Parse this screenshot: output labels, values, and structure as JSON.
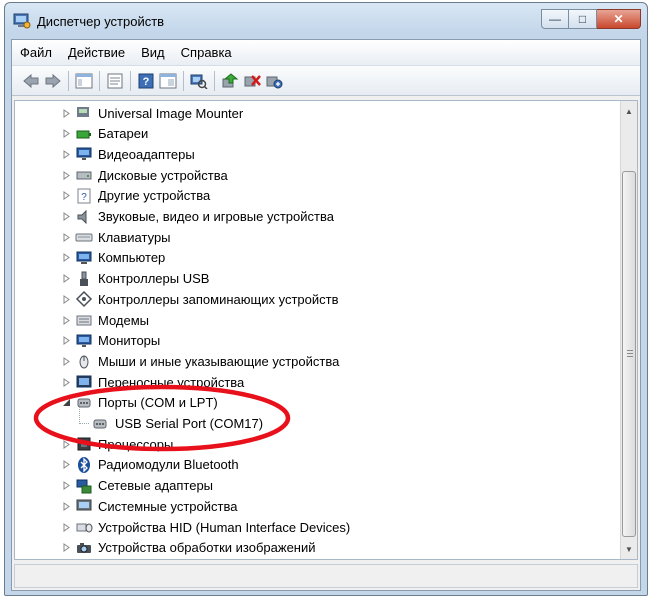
{
  "window": {
    "title": "Диспетчер устройств",
    "buttons": {
      "minimize": "—",
      "maximize": "□",
      "close": "✕"
    }
  },
  "menubar": {
    "items": [
      "Файл",
      "Действие",
      "Вид",
      "Справка"
    ]
  },
  "toolbar": {
    "icons": [
      "back-arrow-icon",
      "forward-arrow-icon",
      "show-hide-tree-icon",
      "properties-icon",
      "help-icon",
      "view-pane-icon",
      "scan-hardware-icon",
      "update-driver-icon",
      "disable-device-icon",
      "uninstall-device-icon"
    ]
  },
  "tree": {
    "nodes": [
      {
        "label": "Universal Image Mounter",
        "icon": "image-mounter-icon",
        "expanded": false
      },
      {
        "label": "Батареи",
        "icon": "battery-icon",
        "expanded": false
      },
      {
        "label": "Видеоадаптеры",
        "icon": "display-adapter-icon",
        "expanded": false
      },
      {
        "label": "Дисковые устройства",
        "icon": "disk-drive-icon",
        "expanded": false
      },
      {
        "label": "Другие устройства",
        "icon": "unknown-device-icon",
        "expanded": false
      },
      {
        "label": "Звуковые, видео и игровые устройства",
        "icon": "speaker-icon",
        "expanded": false
      },
      {
        "label": "Клавиатуры",
        "icon": "keyboard-icon",
        "expanded": false
      },
      {
        "label": "Компьютер",
        "icon": "computer-icon",
        "expanded": false
      },
      {
        "label": "Контроллеры USB",
        "icon": "usb-controller-icon",
        "expanded": false
      },
      {
        "label": "Контроллеры запоминающих устройств",
        "icon": "storage-controller-icon",
        "expanded": false
      },
      {
        "label": "Модемы",
        "icon": "modem-icon",
        "expanded": false
      },
      {
        "label": "Мониторы",
        "icon": "monitor-icon",
        "expanded": false
      },
      {
        "label": "Мыши и иные указывающие устройства",
        "icon": "mouse-icon",
        "expanded": false
      },
      {
        "label": "Переносные устройства",
        "icon": "portable-device-icon",
        "expanded": false
      },
      {
        "label": "Порты (COM и LPT)",
        "icon": "port-icon",
        "expanded": true,
        "children": [
          {
            "label": "USB Serial Port (COM17)",
            "icon": "serial-port-icon"
          }
        ]
      },
      {
        "label": "Процессоры",
        "icon": "processor-icon",
        "expanded": false
      },
      {
        "label": "Радиомодули Bluetooth",
        "icon": "bluetooth-icon",
        "expanded": false
      },
      {
        "label": "Сетевые адаптеры",
        "icon": "network-adapter-icon",
        "expanded": false
      },
      {
        "label": "Системные устройства",
        "icon": "system-device-icon",
        "expanded": false
      },
      {
        "label": "Устройства HID (Human Interface Devices)",
        "icon": "hid-icon",
        "expanded": false
      },
      {
        "label": "Устройства обработки изображений",
        "icon": "imaging-device-icon",
        "expanded": false
      }
    ]
  },
  "highlight": {
    "color": "#e8101a",
    "target": "Порты (COM и LPT)"
  },
  "colors": {
    "titlebar": "#c3d6ea",
    "client_bg": "#f0f0f0",
    "tree_bg": "#ffffff",
    "highlight_red": "#e8101a"
  }
}
